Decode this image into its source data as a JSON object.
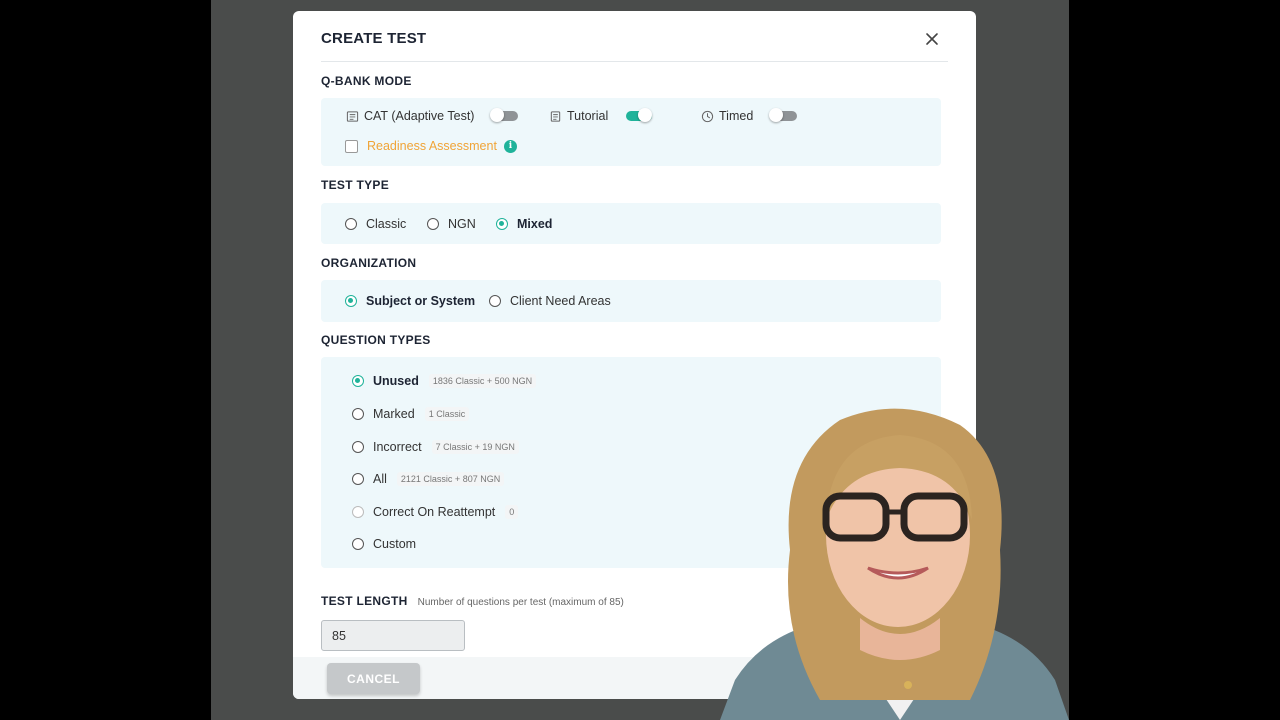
{
  "modal": {
    "title": "CREATE TEST",
    "close_icon": "close-icon"
  },
  "qbank_mode": {
    "label": "Q-BANK MODE",
    "modes": [
      {
        "label": "CAT (Adaptive Test)",
        "icon": "adaptive-test-icon",
        "enabled": false
      },
      {
        "label": "Tutorial",
        "icon": "tutorial-icon",
        "enabled": true
      },
      {
        "label": "Timed",
        "icon": "timer-icon",
        "enabled": false
      }
    ],
    "readiness": {
      "label": "Readiness Assessment",
      "checked": false,
      "info_icon": "info-icon",
      "info_glyph": "i"
    }
  },
  "test_type": {
    "label": "TEST TYPE",
    "options": [
      {
        "label": "Classic",
        "selected": false
      },
      {
        "label": "NGN",
        "selected": false
      },
      {
        "label": "Mixed",
        "selected": true
      }
    ]
  },
  "organization": {
    "label": "ORGANIZATION",
    "options": [
      {
        "label": "Subject or System",
        "selected": true
      },
      {
        "label": "Client Need Areas",
        "selected": false
      }
    ]
  },
  "question_types": {
    "label": "QUESTION TYPES",
    "options": [
      {
        "label": "Unused",
        "count": "1836 Classic + 500 NGN",
        "selected": true
      },
      {
        "label": "Marked",
        "count": "1 Classic",
        "selected": false
      },
      {
        "label": "Incorrect",
        "count": "7 Classic + 19 NGN",
        "selected": false
      },
      {
        "label": "All",
        "count": "2121 Classic + 807 NGN",
        "selected": false
      },
      {
        "label": "Correct On Reattempt",
        "count": "0",
        "selected": false,
        "disabled": true
      },
      {
        "label": "Custom",
        "count": "",
        "selected": false
      }
    ]
  },
  "test_length": {
    "label": "TEST LENGTH",
    "hint": "Number of questions per test (maximum of 85)",
    "value": "85"
  },
  "footer": {
    "cancel_label": "CANCEL"
  },
  "colors": {
    "accent": "#1fb39a",
    "panel_bg": "#eef8fb",
    "readiness": "#f0a437"
  }
}
